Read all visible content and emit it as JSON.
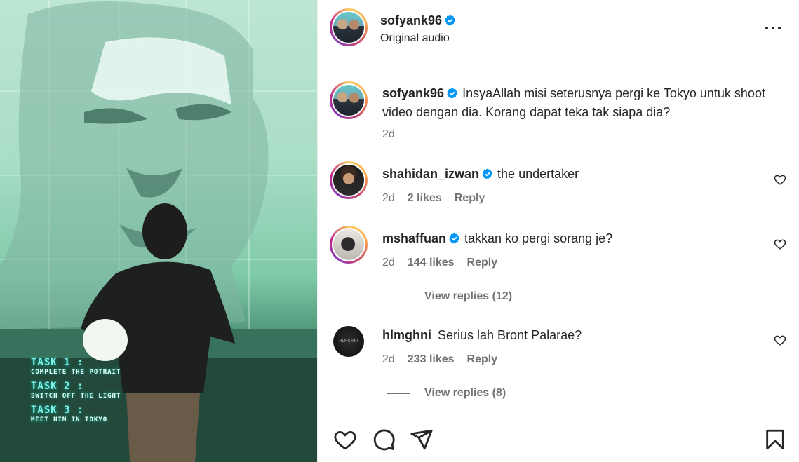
{
  "post": {
    "author": "sofyank96",
    "audio": "Original audio",
    "media_overlay": {
      "tasks": [
        {
          "title": "TASK 1 :",
          "desc": "COMPLETE THE POTRAIT"
        },
        {
          "title": "TASK 2 :",
          "desc": "SWITCH OFF THE LIGHT"
        },
        {
          "title": "TASK 3 :",
          "desc": "MEET HIM IN TOKYO"
        }
      ]
    }
  },
  "caption": {
    "username": "sofyank96",
    "text": "InsyaAllah misi seterusnya pergi ke Tokyo untuk shoot video dengan dia. Korang dapat teka tak siapa dia?",
    "time": "2d"
  },
  "comments": [
    {
      "username": "shahidan_izwan",
      "text": "the undertaker",
      "time": "2d",
      "likes": "2 likes",
      "reply": "Reply"
    },
    {
      "username": "mshaffuan",
      "text": "takkan ko pergi sorang je?",
      "time": "2d",
      "likes": "144 likes",
      "reply": "Reply",
      "view_replies": "View replies (12)"
    },
    {
      "username": "hlmghni",
      "text": "Serius lah Bront Palarae?",
      "time": "2d",
      "likes": "233 likes",
      "reply": "Reply",
      "view_replies": "View replies (8)",
      "avatar_text": "HLMGHNI"
    }
  ],
  "actions": [
    "like-icon",
    "comment-icon",
    "share-icon",
    "save-icon"
  ],
  "colors": {
    "verified": "#0095f6",
    "text": "#262626",
    "muted": "#737373",
    "border": "#efefef"
  }
}
